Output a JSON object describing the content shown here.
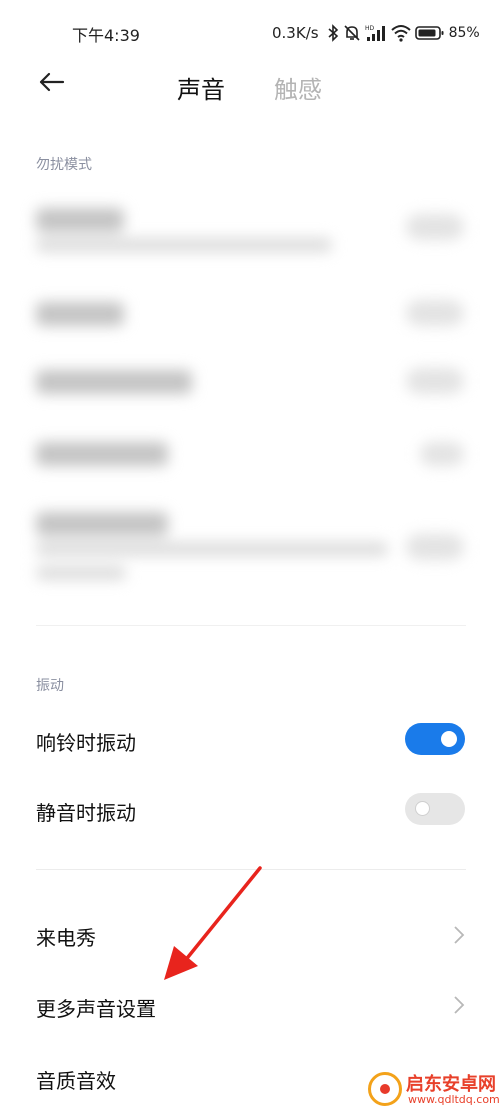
{
  "status_bar": {
    "time": "下午4:39",
    "network_speed": "0.3K/s",
    "battery": "85%",
    "icons": [
      "bluetooth-icon",
      "mute-bell-icon",
      "hd-signal-icon",
      "wifi-icon",
      "battery-icon"
    ]
  },
  "header": {
    "back_icon": "back-arrow-icon",
    "tabs": [
      {
        "label": "声音",
        "active": true
      },
      {
        "label": "触感",
        "active": false
      }
    ]
  },
  "dnd_section": {
    "label": "勿扰模式"
  },
  "vibration_section": {
    "label": "振动",
    "items": [
      {
        "label": "响铃时振动",
        "enabled": true
      },
      {
        "label": "静音时振动",
        "enabled": false
      }
    ]
  },
  "links": [
    {
      "label": "来电秀",
      "icon": "chevron-right-icon"
    },
    {
      "label": "更多声音设置",
      "icon": "chevron-right-icon"
    },
    {
      "label": "音质音效",
      "icon": "chevron-right-icon"
    }
  ],
  "watermark": {
    "name": "启东安卓网",
    "url": "www.qdltdq.com"
  },
  "colors": {
    "accent": "#1a7bea",
    "annotation_arrow": "#e8241d",
    "inactive_tab": "#b4b4b4",
    "section_label": "#8a8fa0"
  }
}
